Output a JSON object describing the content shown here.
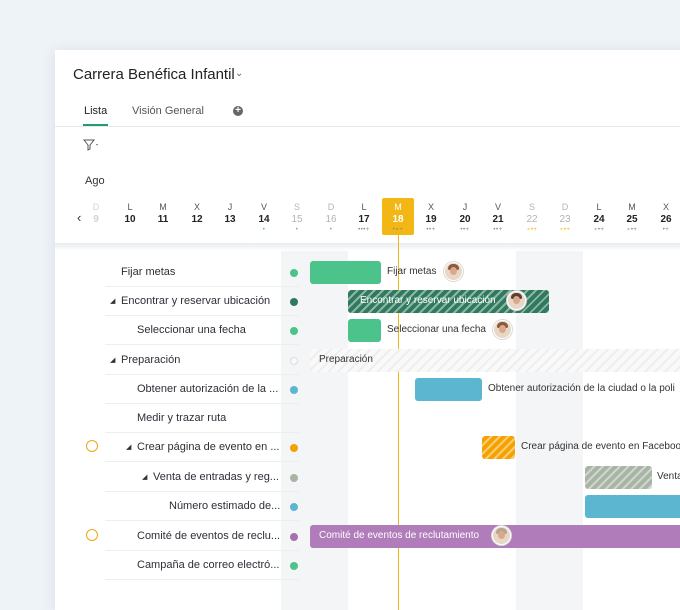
{
  "project": {
    "title": "Carrera Benéfica Infantil"
  },
  "tabs": [
    {
      "label": "Lista"
    },
    {
      "label": "Visión General"
    }
  ],
  "timeline": {
    "month": "Ago",
    "days": [
      {
        "letter": "D",
        "num": "9"
      },
      {
        "letter": "L",
        "num": "10"
      },
      {
        "letter": "M",
        "num": "11"
      },
      {
        "letter": "X",
        "num": "12"
      },
      {
        "letter": "J",
        "num": "13"
      },
      {
        "letter": "V",
        "num": "14"
      },
      {
        "letter": "S",
        "num": "15"
      },
      {
        "letter": "D",
        "num": "16"
      },
      {
        "letter": "L",
        "num": "17"
      },
      {
        "letter": "M",
        "num": "18"
      },
      {
        "letter": "X",
        "num": "19"
      },
      {
        "letter": "J",
        "num": "20"
      },
      {
        "letter": "V",
        "num": "21"
      },
      {
        "letter": "S",
        "num": "22"
      },
      {
        "letter": "D",
        "num": "23"
      },
      {
        "letter": "L",
        "num": "24"
      },
      {
        "letter": "M",
        "num": "25"
      },
      {
        "letter": "X",
        "num": "26"
      }
    ]
  },
  "tasks": [
    {
      "label": "Fijar metas",
      "status_color": "#4cc38a",
      "bar_label": "Fijar metas"
    },
    {
      "label": "Encontrar y reservar ubicación",
      "status_color": "#2f7a5e",
      "bar_label": "Encontrar y reservar ubicación"
    },
    {
      "label": "Seleccionar una fecha",
      "status_color": "#4cc38a",
      "bar_label": "Seleccionar una fecha"
    },
    {
      "label": "Preparación",
      "status_color": "#dddddd",
      "bar_label": "Preparación"
    },
    {
      "label": "Obtener autorización de la ...",
      "status_color": "#5db6cf",
      "bar_label": "Obtener autorización de la ciudad o la poli"
    },
    {
      "label": "Medir y trazar ruta",
      "status_color": "",
      "bar_label": ""
    },
    {
      "label": "Crear página de evento en ...",
      "status_color": "#f5a200",
      "bar_label": "Crear página de evento en Faceboo"
    },
    {
      "label": "Venta de entradas y reg...",
      "status_color": "#a8b4a4",
      "bar_label": "Venta"
    },
    {
      "label": "Número estimado de...",
      "status_color": "#5db6cf",
      "bar_label": ""
    },
    {
      "label": "Comité de eventos de reclu...",
      "status_color": "#a86fb0",
      "bar_label": "Comité de eventos de reclutamiento"
    },
    {
      "label": "Campaña de correo electró...",
      "status_color": "#4cc38a",
      "bar_label": ""
    }
  ]
}
